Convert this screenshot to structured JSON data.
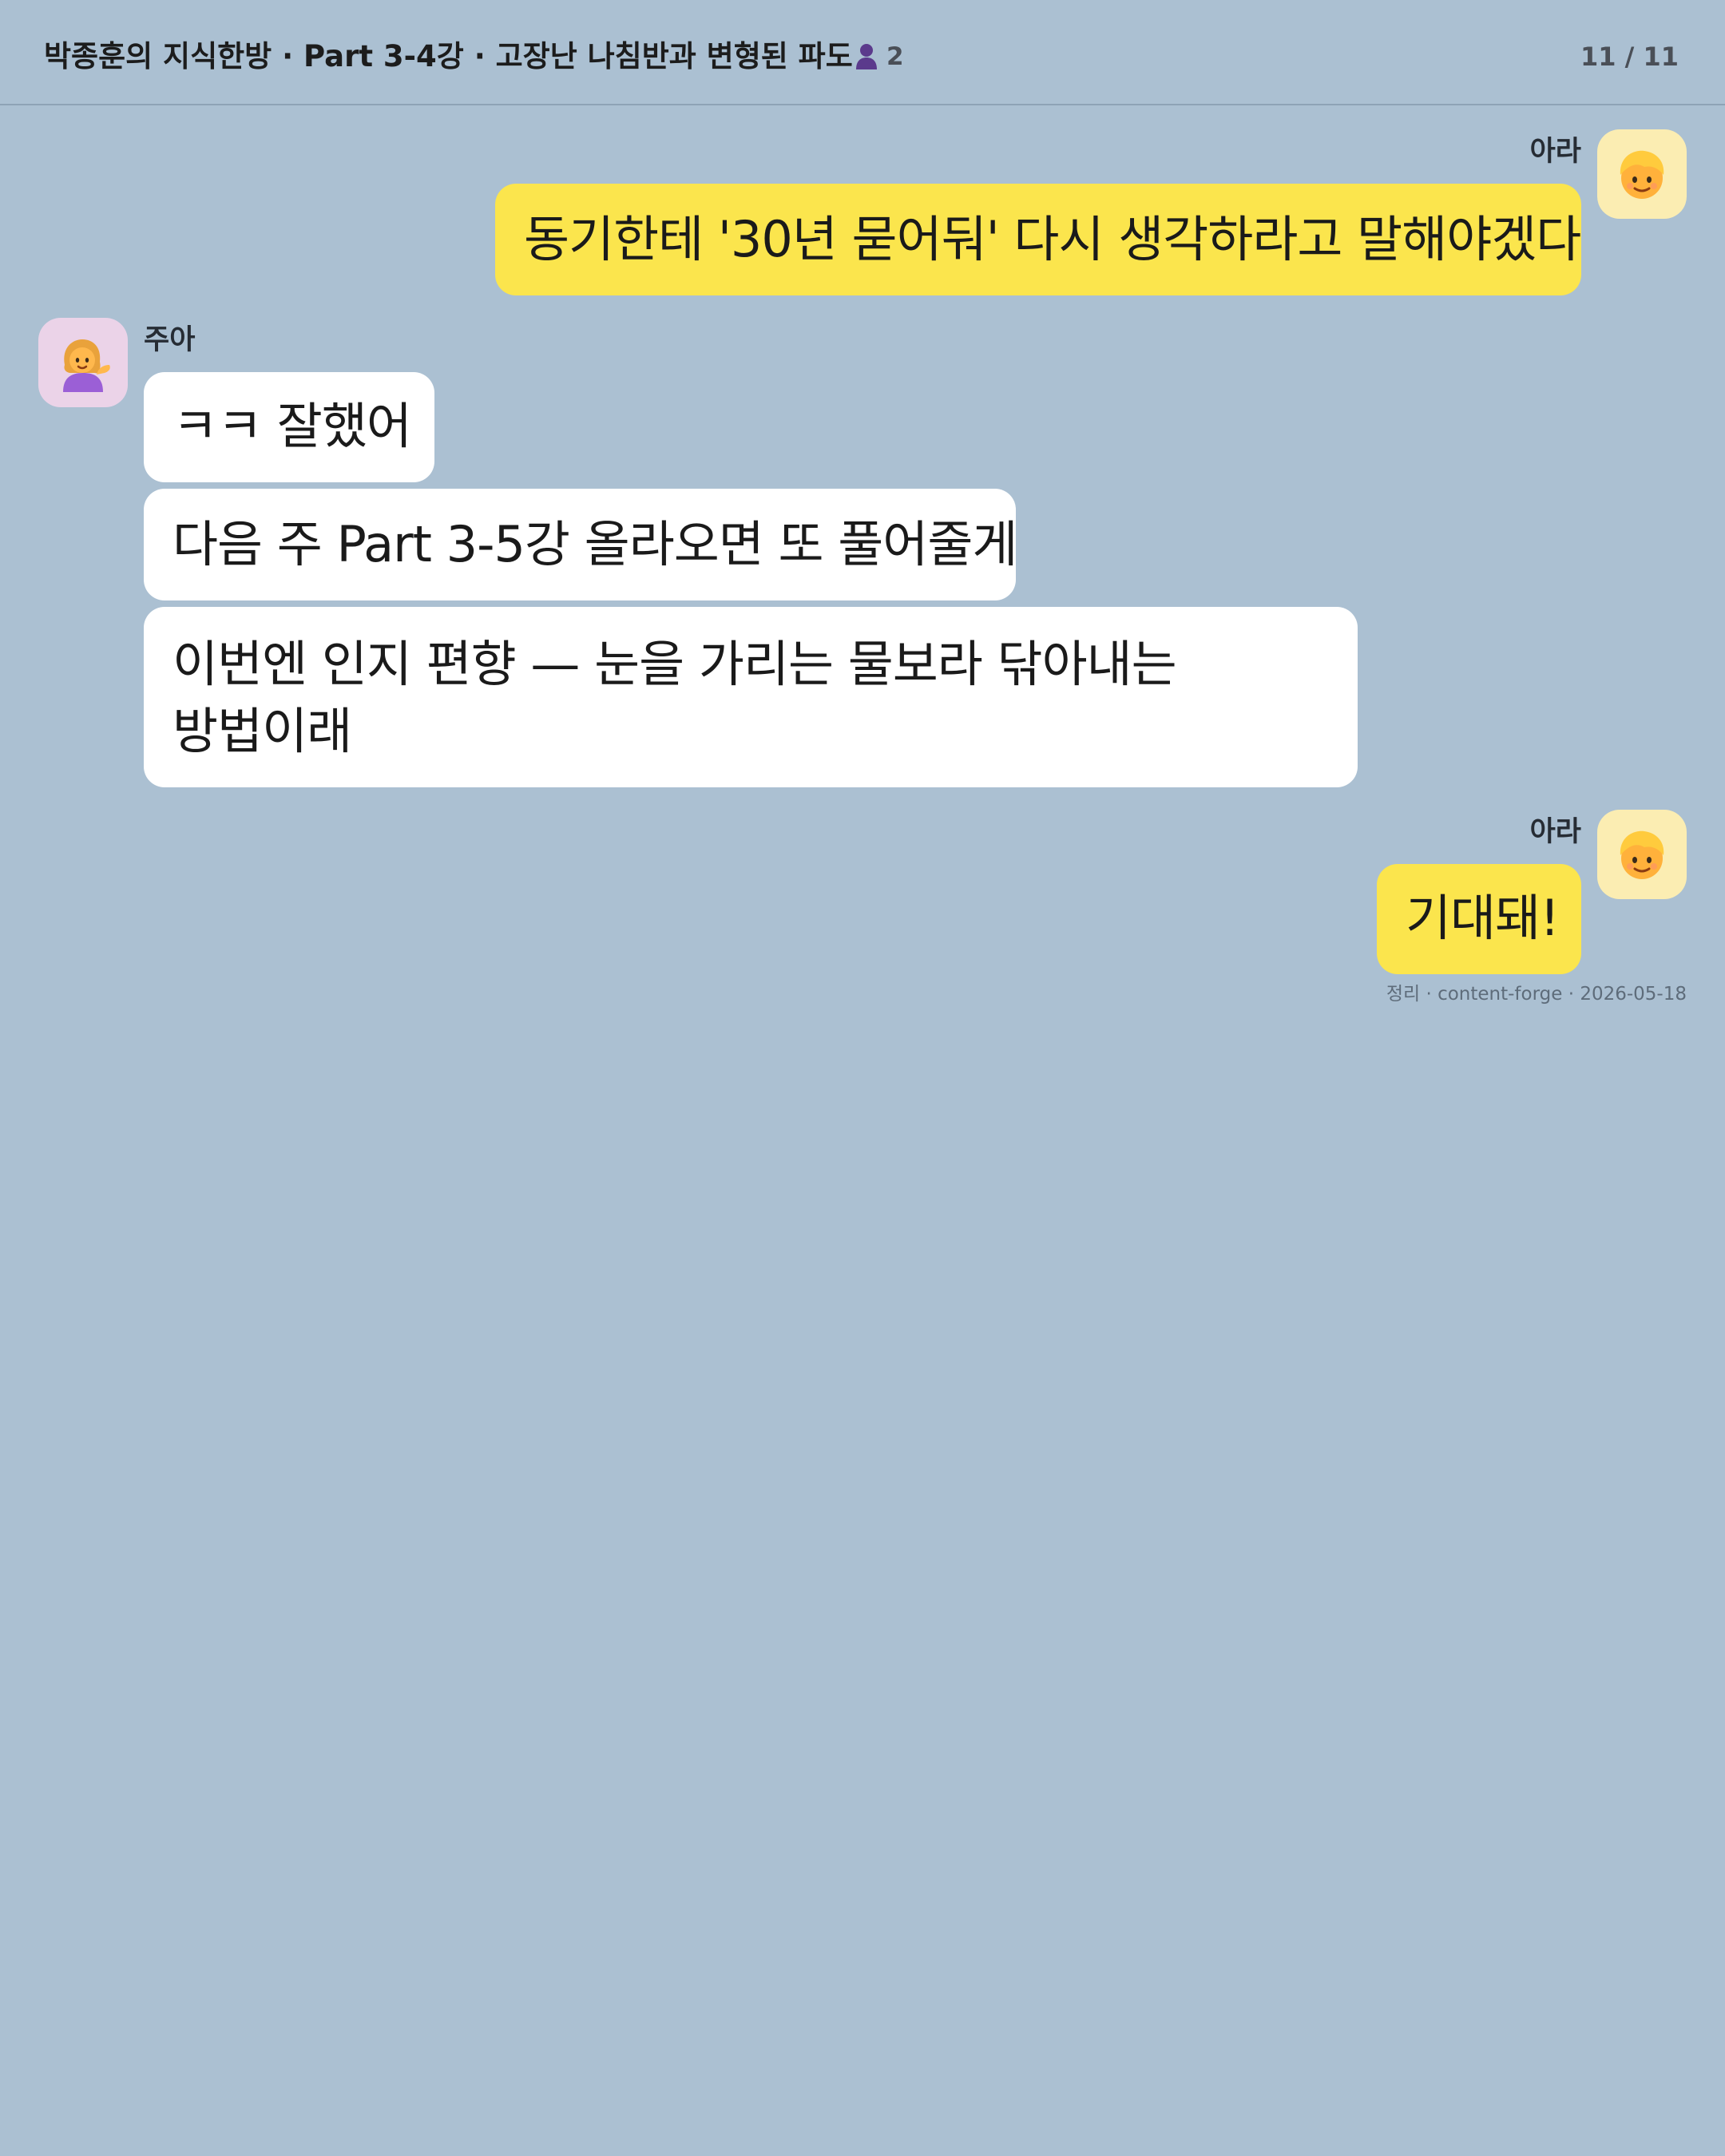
{
  "header": {
    "title": "박종훈의 지식한방 · Part 3-4강 · 고장난 나침반과 변형된 파도",
    "member_count": "2",
    "page_counter": "11 / 11"
  },
  "messages": [
    {
      "sender": "아라",
      "direction": "outgoing",
      "avatar_icon": "blond-child-emoji",
      "text": "동기한테 '30년 묻어둬' 다시 생각하라고 말해야겠다"
    },
    {
      "sender": "주아",
      "direction": "incoming",
      "avatar_icon": "woman-tipping-hand-emoji",
      "texts": [
        "ㅋㅋ 잘했어",
        "다음 주 Part 3-5강 올라오면 또 풀어줄게",
        "이번엔 인지 편향 — 눈을 가리는 물보라 닦아내는",
        "방법이래"
      ]
    },
    {
      "sender": "아라",
      "direction": "outgoing",
      "avatar_icon": "blond-child-emoji",
      "text": "기대돼!"
    }
  ],
  "footer_note": "정리 · content-forge · 2026-05-18",
  "colors": {
    "background": "#abc0d2",
    "outgoing_bubble": "#fbe54d",
    "incoming_bubble": "#ffffff",
    "ara_avatar_bg": "#fbedb2",
    "jua_avatar_bg": "#ebd3e8",
    "member_icon": "#5b3a8c"
  }
}
